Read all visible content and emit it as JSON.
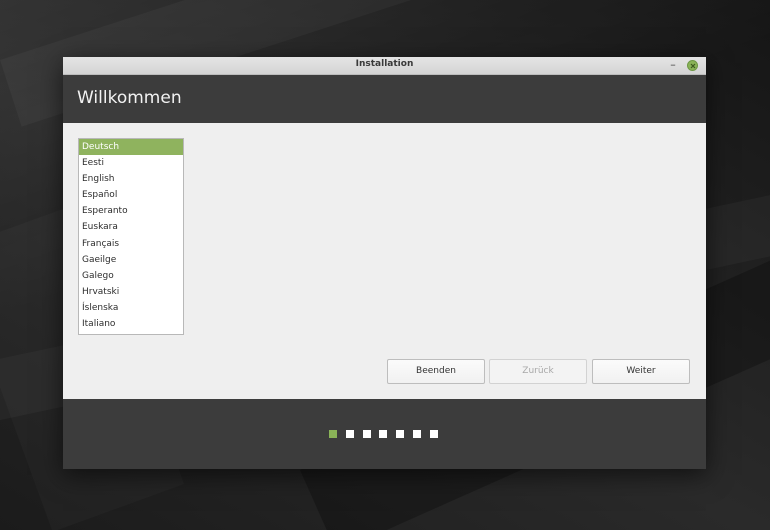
{
  "window": {
    "title": "Installation",
    "minimize_label": "–"
  },
  "header": {
    "title": "Willkommen"
  },
  "languages": {
    "items": [
      "Deutsch",
      "Eesti",
      "English",
      "Español",
      "Esperanto",
      "Euskara",
      "Français",
      "Gaeilge",
      "Galego",
      "Hrvatski",
      "Íslenska",
      "Italiano"
    ],
    "selected": "Deutsch"
  },
  "buttons": {
    "quit": "Beenden",
    "back": "Zurück",
    "next": "Weiter"
  },
  "progress": {
    "total_steps": 7,
    "current_step": 1
  },
  "colors": {
    "accent": "#8ab358",
    "header_bg": "#3c3c3c",
    "content_bg": "#efefef"
  }
}
